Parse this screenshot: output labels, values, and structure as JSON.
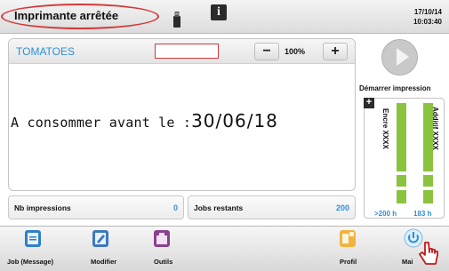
{
  "header": {
    "status": "Imprimante arrêtée",
    "date": "17/10/14",
    "time": "10:03:40"
  },
  "message": {
    "name": "TOMATOES",
    "zoom": "100%",
    "zoom_minus": "−",
    "zoom_plus": "+",
    "label_text": "A consommer avant le :",
    "date_value": "30/06/18"
  },
  "counters": {
    "nb_impressions_label": "Nb impressions",
    "nb_impressions_value": "0",
    "jobs_restants_label": "Jobs restants",
    "jobs_restants_value": "200"
  },
  "start": {
    "label": "Démarrer impression"
  },
  "levels": {
    "plus": "+",
    "ink_label": "Encre XXXX",
    "ink_time": ">200 h",
    "additive_label": "Additif XXXX",
    "additive_time": "183 h",
    "ink_color": "#8ac43f"
  },
  "toolbar": {
    "job_label": "Job (Message)",
    "modify_label": "Modifier",
    "tools_label": "Outils",
    "profile_label": "Profil",
    "maintenance_label": "Mai"
  },
  "colors": {
    "accent": "#2d8fd8",
    "highlight": "#d23a3a",
    "level": "#8ac43f"
  }
}
